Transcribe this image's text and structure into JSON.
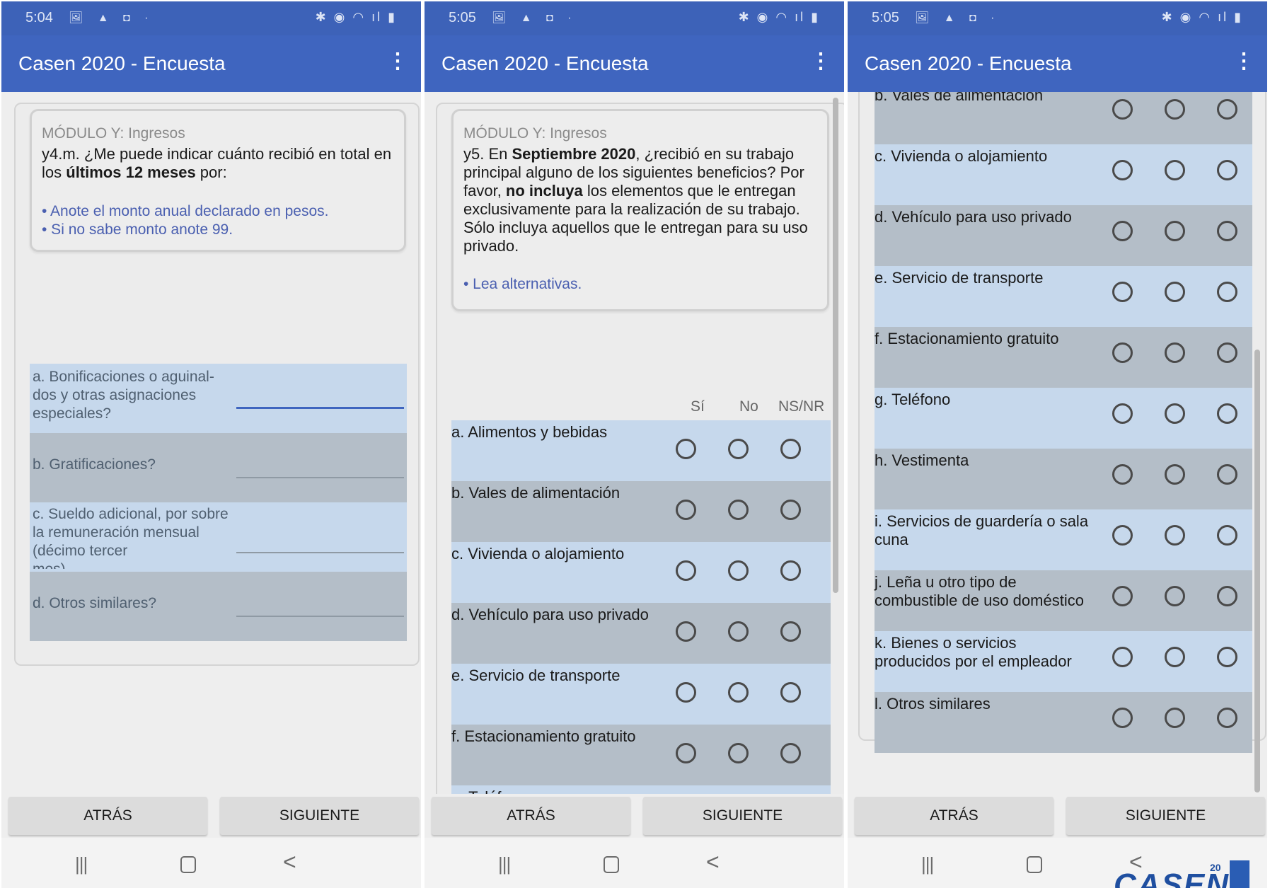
{
  "screens": [
    {
      "status_time": "5:04",
      "status_left_icons": "🖼 ▲ ◘ ·",
      "status_right_icons": "✱ ◉ ◠ ıl ▮",
      "app_title": "Casen 2020 - Encuesta",
      "menu_icon": "⋮",
      "module": "MÓDULO Y: Ingresos",
      "question": {
        "pre": "y4.m. ¿Me puede indicar cuánto recibió en total en los ",
        "bold1": "últimos 12 meses",
        "post": " por:"
      },
      "instructions": [
        "• Anote el monto anual declarado en pesos.",
        "• Si no sabe monto anote 99."
      ],
      "fields": [
        "a. Bonificaciones o aguinal-dos y otras asignaciones especiales?",
        "b. Gratificaciones?",
        "c. Sueldo adicional, por sobre la remuneración mensual (décimo tercer",
        "d. Otros similares?"
      ],
      "field_c_cut": "mes)",
      "back_label": "ATRÁS",
      "next_label": "SIGUIENTE"
    },
    {
      "status_time": "5:05",
      "status_left_icons": "🖼 ▲ ◘ ·",
      "status_right_icons": "✱ ◉ ◠ ıl ▮",
      "app_title": "Casen 2020 - Encuesta",
      "menu_icon": "⋮",
      "module": "MÓDULO Y: Ingresos",
      "question": {
        "t1": "y5. En ",
        "b1": "Septiembre 2020",
        "t2": ", ¿recibió en su trabajo principal alguno de los siguientes beneficios? Por favor, ",
        "b2": "no incluya",
        "t3": " los elementos que le entregan exclusivamente para la realización de su trabajo. Sólo incluya aquellos que le entregan para su uso privado."
      },
      "instruction": "• Lea alternativas.",
      "col_headers": [
        "Sí",
        "No",
        "NS/NR"
      ],
      "rows": [
        "a. Alimentos y bebidas",
        "b. Vales de alimentación",
        "c. Vivienda o alojamiento",
        "d. Vehículo para uso privado",
        "e. Servicio de transporte",
        "f. Estacionamiento gratuito"
      ],
      "cut_row": "g. Teléfono",
      "back_label": "ATRÁS",
      "next_label": "SIGUIENTE"
    },
    {
      "status_time": "5:05",
      "status_left_icons": "🖼 ▲ ◘ ·",
      "status_right_icons": "✱ ◉ ◠ ıl ▮",
      "app_title": "Casen 2020 - Encuesta",
      "menu_icon": "⋮",
      "top_cut_row": "b. Vales de alimentación",
      "rows": [
        "c. Vivienda o alojamiento",
        "d. Vehículo para uso privado",
        "e. Servicio de transporte",
        "f. Estacionamiento gratuito",
        "g. Teléfono",
        "h. Vestimenta",
        "i. Servicios de guardería o sala\ncuna",
        "j. Leña u otro tipo de\ncombustible de uso doméstico",
        "k. Bienes o servicios\nproducidos por el empleador",
        "l. Otros similares"
      ],
      "back_label": "ATRÁS",
      "next_label": "SIGUIENTE"
    }
  ],
  "nav": {
    "recent_icon": "|||",
    "back_icon": "<"
  },
  "logo": {
    "text": "CASEN",
    "sup": "20"
  },
  "colors": {
    "app_bar": "#3f65bf",
    "row_light": "#c6d8ec",
    "row_dark": "#b4bec8",
    "instruction_text": "#4a5fb0"
  }
}
